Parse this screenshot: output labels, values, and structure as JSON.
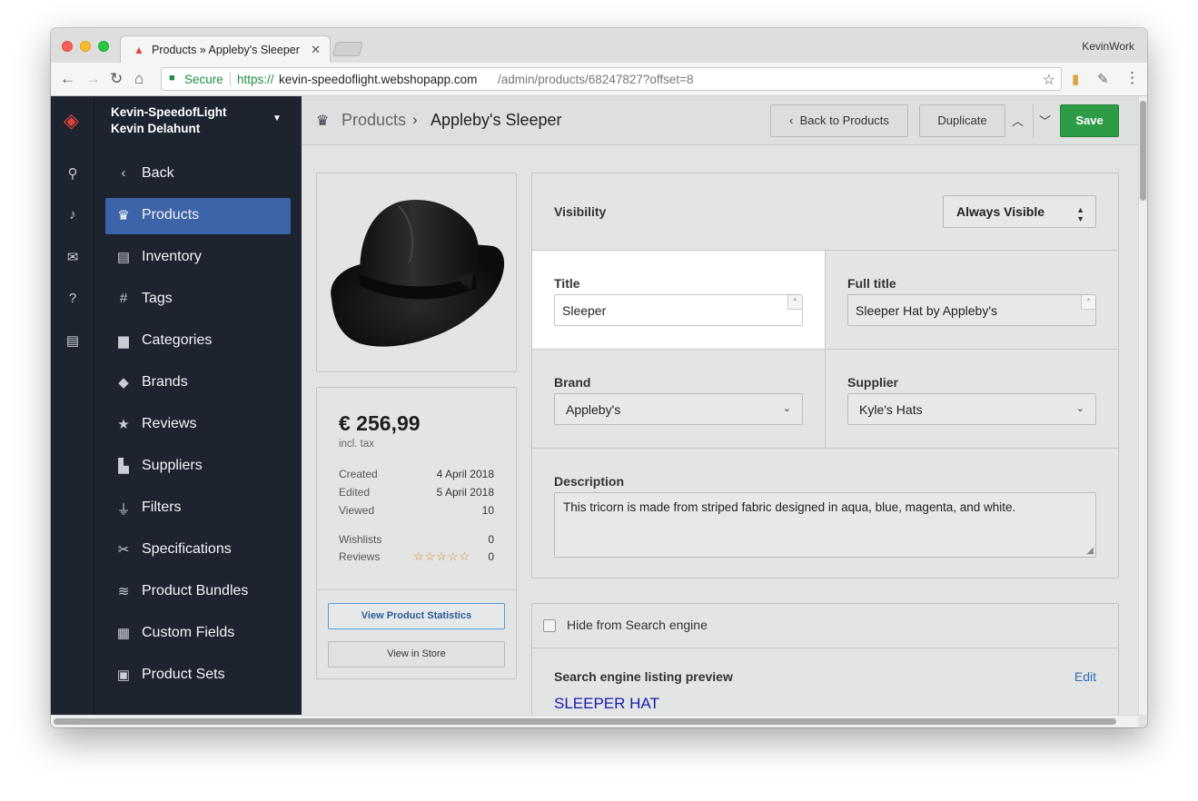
{
  "browser": {
    "tab_title": "Products » Appleby's Sleeper",
    "profile": "KevinWork",
    "secure_label": "Secure",
    "url_scheme": "https://",
    "url_host": "kevin-speedoflight.webshopapp.com",
    "url_path": "/admin/products/68247827?offset=8"
  },
  "account": {
    "store": "Kevin-SpeedofLight",
    "user": "Kevin Delahunt"
  },
  "sidebar": {
    "items": [
      {
        "label": "Back",
        "icon": "chevron-left-icon"
      },
      {
        "label": "Products",
        "icon": "tshirt-icon",
        "active": true
      },
      {
        "label": "Inventory",
        "icon": "inventory-icon"
      },
      {
        "label": "Tags",
        "icon": "hash-icon"
      },
      {
        "label": "Categories",
        "icon": "folder-icon"
      },
      {
        "label": "Brands",
        "icon": "tag-icon"
      },
      {
        "label": "Reviews",
        "icon": "star-review-icon"
      },
      {
        "label": "Suppliers",
        "icon": "factory-icon"
      },
      {
        "label": "Filters",
        "icon": "filter-icon"
      },
      {
        "label": "Specifications",
        "icon": "ruler-pencil-icon"
      },
      {
        "label": "Product Bundles",
        "icon": "layers-icon"
      },
      {
        "label": "Custom Fields",
        "icon": "custom-fields-icon"
      },
      {
        "label": "Product Sets",
        "icon": "product-set-icon"
      }
    ]
  },
  "breadcrumb": {
    "section": "Products",
    "current": "Appleby's Sleeper"
  },
  "toolbar": {
    "back_label": "Back to Products",
    "duplicate_label": "Duplicate",
    "save_label": "Save"
  },
  "price_card": {
    "price": "€ 256,99",
    "tax_note": "incl. tax",
    "stats": [
      {
        "label": "Created",
        "value": "4 April 2018"
      },
      {
        "label": "Edited",
        "value": "5 April 2018"
      },
      {
        "label": "Viewed",
        "value": "10"
      },
      {
        "label": "Wishlists",
        "value": "0"
      },
      {
        "label": "Reviews",
        "value": "0",
        "stars": 0
      }
    ],
    "stats_button": "View Product Statistics",
    "store_button": "View in Store"
  },
  "form": {
    "visibility_label": "Visibility",
    "visibility_value": "Always Visible",
    "title_label": "Title",
    "title_value": "Sleeper",
    "full_title_label": "Full title",
    "full_title_value": "Sleeper Hat by Appleby's",
    "brand_label": "Brand",
    "brand_value": "Appleby's",
    "supplier_label": "Supplier",
    "supplier_value": "Kyle's Hats",
    "description_label": "Description",
    "description_value": "This tricorn is made from striped fabric designed in aqua, blue, magenta, and white.",
    "required_marker": "*"
  },
  "seo": {
    "hide_label": "Hide from Search engine",
    "preview_label": "Search engine listing preview",
    "edit_label": "Edit",
    "preview_title": "SLEEPER HAT"
  },
  "colors": {
    "sidebar_bg": "#1d2430",
    "active_item": "#3d63a8",
    "save_button": "#2e9b46",
    "brand_logo": "#e0433d",
    "link": "#2f6db5"
  }
}
